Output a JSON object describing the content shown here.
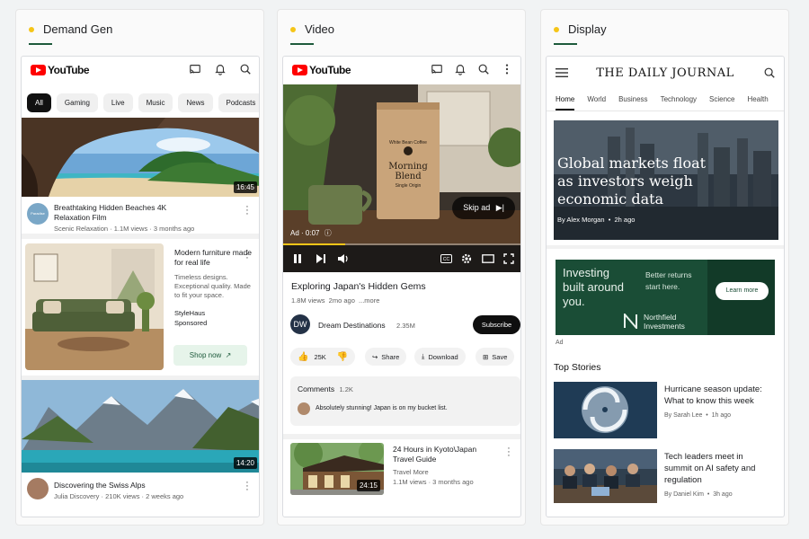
{
  "colors": {
    "accent_dot": "#f5c518",
    "brand_green": "#1e5a3c",
    "youtube_red": "#ff0000"
  },
  "panels": {
    "demand_gen": {
      "title": "Demand Gen",
      "app": {
        "logo": "YouTube",
        "icons": [
          "cast-icon",
          "bell-icon",
          "search-icon"
        ]
      },
      "chips": [
        "All",
        "Gaming",
        "Live",
        "Music",
        "News",
        "Podcasts"
      ],
      "video1": {
        "title": "Breathtaking Hidden Beaches 4K Relaxation Film",
        "meta": "Scenic Relaxation · 1.1M views · 3 months ago",
        "duration": "16:45",
        "avatar_text": "Paradise"
      },
      "ad": {
        "title": "Modern furniture made for real life",
        "description": "Timeless designs. Exceptional quality. Made to fit your space.",
        "brand": "StyleHaus",
        "sponsored": "Sponsored",
        "cta": "Shop now"
      },
      "video2": {
        "title": "Discovering the Swiss Alps",
        "meta": "Julia Discovery · 210K views · 2 weeks ago",
        "duration": "14:20"
      }
    },
    "video": {
      "title": "Video",
      "app": {
        "logo": "YouTube",
        "icons": [
          "cast-icon",
          "bell-icon",
          "search-icon",
          "more-vert-icon"
        ]
      },
      "player": {
        "product_brand": "White Bean Coffee",
        "product_name_1": "Morning",
        "product_name_2": "Blend",
        "product_sub": "Single Origin",
        "skip_label": "Skip ad",
        "ad_time": "Ad · 0:07",
        "progress_fraction": 0.26
      },
      "video_title": "Exploring Japan's Hidden Gems",
      "video_meta": "1.8M views  2mo ago  ...more",
      "channel": {
        "avatar": "DW",
        "name": "Dream Destinations",
        "subs": "2.35M",
        "subscribe_label": "Subscribe"
      },
      "actions": {
        "likes": "25K",
        "share": "Share",
        "download": "Download",
        "save": "Save"
      },
      "comments": {
        "label": "Comments",
        "count": "1.2K",
        "top_comment": "Absolutely stunning! Japan is on my bucket list."
      },
      "next_video": {
        "title": "24 Hours in Kyoto\\Japan Travel Guide",
        "channel": "Travel More",
        "meta": "1.1M views · 3 months ago",
        "duration": "24:15"
      }
    },
    "display": {
      "title": "Display",
      "masthead": "THE DAILY JOURNAL",
      "nav": [
        "Home",
        "World",
        "Business",
        "Technology",
        "Science",
        "Health"
      ],
      "hero": {
        "headline": "Global markets float as investors weigh economic data",
        "byline": "By Alex Morgan  •  2h ago"
      },
      "ad": {
        "headline": "Investing built around you.",
        "sub": "Better returns start here.",
        "cta": "Learn more",
        "brand_line1": "Northfield",
        "brand_line2": "Investments",
        "label": "Ad"
      },
      "top_stories_label": "Top Stories",
      "stories": [
        {
          "title": "Hurricane season update: What to know this week",
          "byline": "By Sarah Lee  •  1h ago"
        },
        {
          "title": "Tech leaders meet in summit on AI safety and regulation",
          "byline": "By Daniel Kim  •  3h ago"
        }
      ]
    }
  }
}
